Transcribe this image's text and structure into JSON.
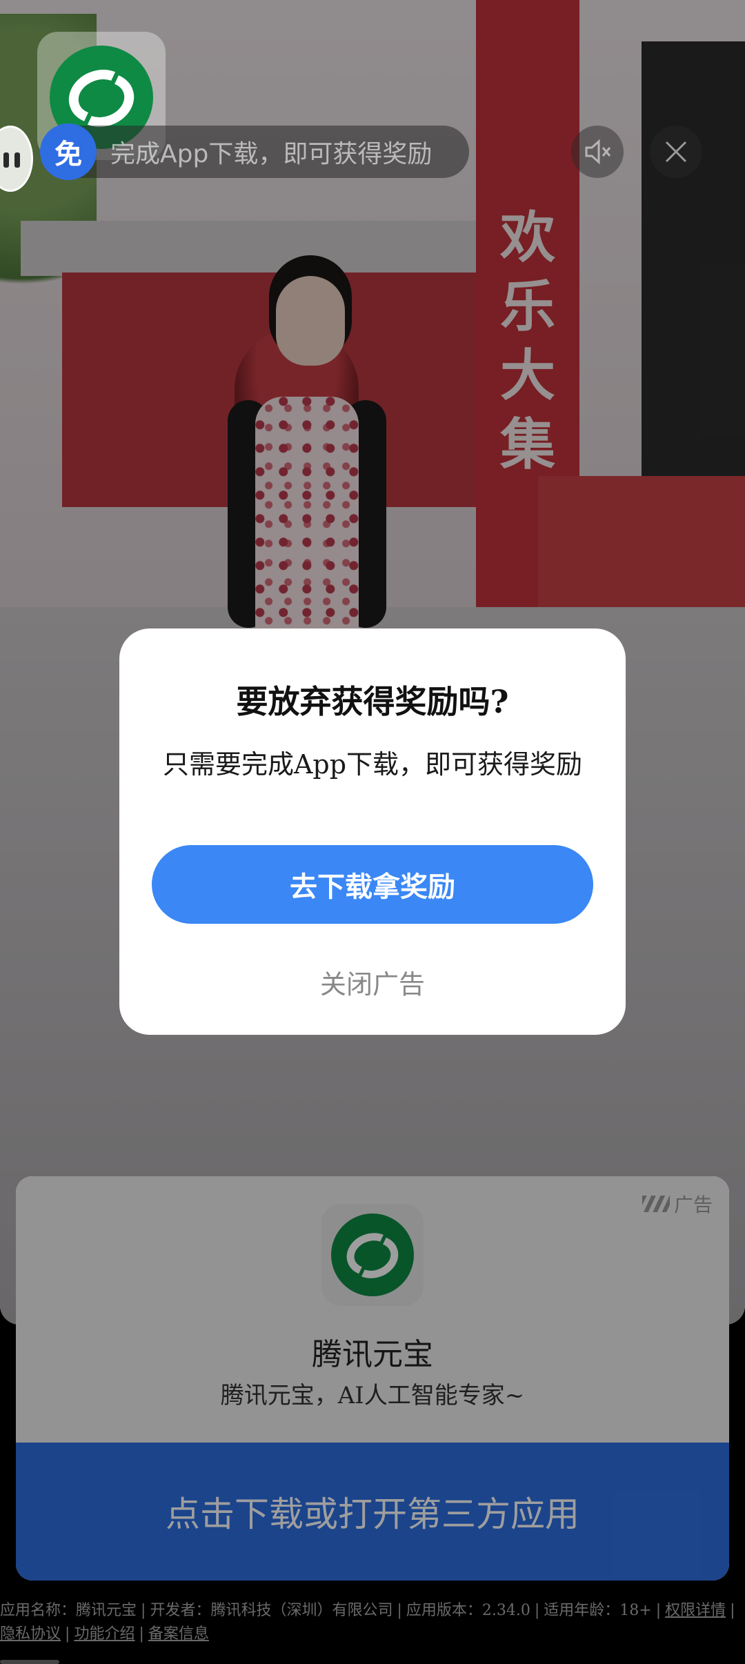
{
  "top_bar": {
    "reward_badge": "免",
    "reward_text": "完成App下载，即可获得奖励"
  },
  "scene": {
    "tower_chars": [
      "欢",
      "乐",
      "大",
      "集"
    ]
  },
  "dialog": {
    "title": "要放弃获得奖励吗?",
    "body": "只需要完成App下载，即可获得奖励",
    "primary_button": "去下载拿奖励",
    "dismiss": "关闭广告"
  },
  "ad_card": {
    "ad_label": "广告",
    "app_name": "腾讯元宝",
    "app_desc": "腾讯元宝，AI人工智能专家~",
    "cta": "点击下载或打开第三方应用"
  },
  "footer": {
    "app_name_label": "应用名称：腾讯元宝",
    "developer": "开发者：腾讯科技（深圳）有限公司",
    "version": "应用版本：2.34.0",
    "age": "适用年龄：18+",
    "permissions": "权限详情",
    "privacy": "隐私协议",
    "features": "功能介绍",
    "filing": "备案信息",
    "separator": "|"
  },
  "colors": {
    "primary_blue": "#3a87f5",
    "cta_blue": "#2d6fe0",
    "brand_green": "#0e8a44"
  }
}
